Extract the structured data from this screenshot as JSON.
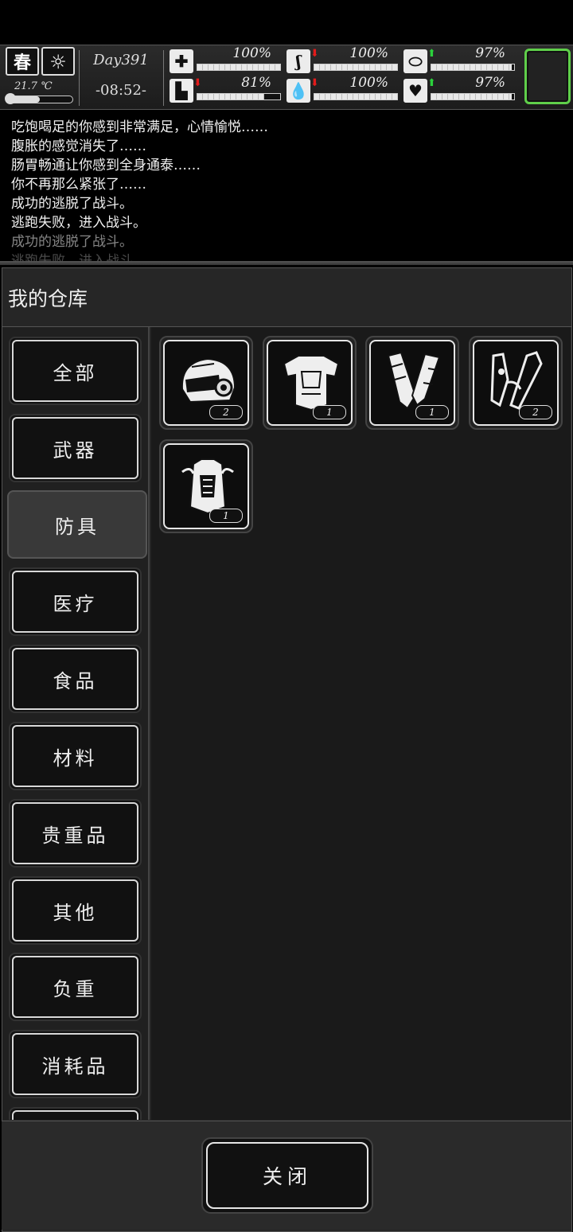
{
  "status": {
    "season": "春",
    "weather_icon": "sun-icon",
    "temperature": "21.7 ℃",
    "temperature_level": 0.5,
    "day": "Day391",
    "time": "-08:52-",
    "stats": [
      {
        "name": "health",
        "icon": "medkit-icon",
        "arrow": "",
        "value": "100%",
        "level": 1.0
      },
      {
        "name": "hunger",
        "icon": "stomach-icon",
        "arrow": "down",
        "value": "100%",
        "level": 1.0
      },
      {
        "name": "medicine",
        "icon": "pill-icon",
        "arrow": "up",
        "value": "97%",
        "level": 0.97
      },
      {
        "name": "stamina",
        "icon": "boot-icon",
        "arrow": "down",
        "value": "81%",
        "level": 0.81
      },
      {
        "name": "thirst",
        "icon": "water-drop-icon",
        "arrow": "down",
        "value": "100%",
        "level": 1.0
      },
      {
        "name": "mood",
        "icon": "heart-icon",
        "arrow": "up",
        "value": "97%",
        "level": 0.97
      }
    ],
    "accent_up": "#2bd13c",
    "accent_down": "#e21b1b",
    "slot_border": "#5fcf4a"
  },
  "log": [
    "吃饱喝足的你感到非常满足，心情愉悦……",
    "腹胀的感觉消失了……",
    "肠胃畅通让你感到全身通泰……",
    "你不再那么紧张了……",
    "成功的逃脱了战斗。",
    "逃跑失败，进入战斗。",
    "成功的逃脱了战斗。",
    "逃跑失败，进入战斗。"
  ],
  "warehouse": {
    "title": "我的仓库",
    "categories": [
      "全部",
      "武器",
      "防具",
      "医疗",
      "食品",
      "材料",
      "贵重品",
      "其他",
      "负重",
      "消耗品"
    ],
    "active_category": "防具",
    "items": [
      {
        "name": "helmet",
        "count": "2"
      },
      {
        "name": "body-armor",
        "count": "1"
      },
      {
        "name": "arm-guards",
        "count": "1"
      },
      {
        "name": "leg-armor",
        "count": "2"
      },
      {
        "name": "armor-vest",
        "count": "1"
      }
    ]
  },
  "footer": {
    "close_label": "关闭"
  }
}
